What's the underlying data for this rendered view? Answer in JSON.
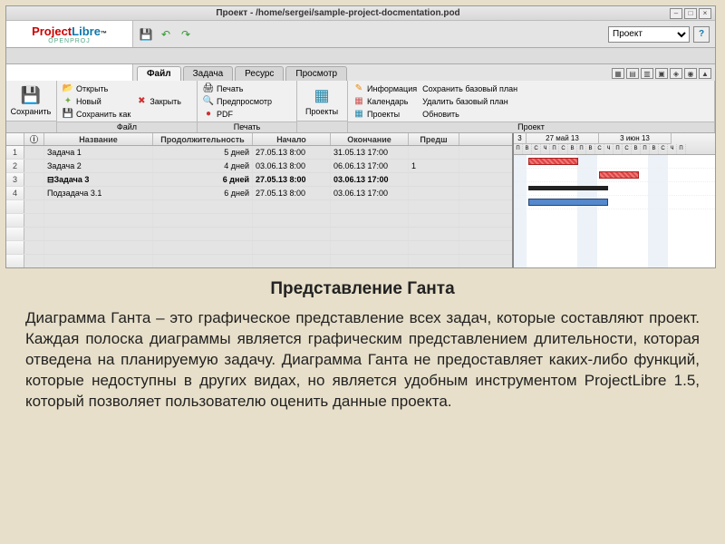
{
  "window": {
    "title": "Проект - /home/sergei/sample-project-docmentation.pod"
  },
  "logo": {
    "p": "Project",
    "l": "Libre",
    "tm": "™",
    "sub": "OPENPROJ"
  },
  "combo": {
    "selected": "Проект"
  },
  "tabs": {
    "file": "Файл",
    "task": "Задача",
    "resource": "Ресурс",
    "view": "Просмотр"
  },
  "ribbon": {
    "save": "Сохранить",
    "file_group": "Файл",
    "open": "Открыть",
    "new": "Новый",
    "saveas": "Сохранить как",
    "close": "Закрыть",
    "print_group": "Печать",
    "print": "Печать",
    "preview": "Предпросмотр",
    "pdf": "PDF",
    "projects": "Проекты",
    "project_group": "Проект",
    "info": "Информация",
    "calendar": "Календарь",
    "projects2": "Проекты",
    "save_baseline": "Сохранить базовый план",
    "delete_baseline": "Удалить базовый план",
    "refresh": "Обновить"
  },
  "columns": {
    "indicator": "ⓘ",
    "name": "Название",
    "duration": "Продолжительность",
    "start": "Начало",
    "end": "Окончание",
    "pred": "Предш"
  },
  "rows": [
    {
      "n": "1",
      "name": "Задача 1",
      "dur": "5 дней",
      "start": "27.05.13 8:00",
      "end": "31.05.13 17:00",
      "pred": ""
    },
    {
      "n": "2",
      "name": "Задача 2",
      "dur": "4 дней",
      "start": "03.06.13 8:00",
      "end": "06.06.13 17:00",
      "pred": "1"
    },
    {
      "n": "3",
      "name": "⊟Задача 3",
      "dur": "6 дней",
      "start": "27.05.13 8:00",
      "end": "03.06.13 17:00",
      "pred": "",
      "bold": true
    },
    {
      "n": "4",
      "name": "   Подзадача 3.1",
      "dur": "6 дней",
      "start": "27.05.13 8:00",
      "end": "03.06.13 17:00",
      "pred": ""
    }
  ],
  "timeline": {
    "w1": "3",
    "w2": "27 май 13",
    "w3": "3 июн 13",
    "days": "П В С Ч П С В П В С Ч П С В П В С Ч П"
  },
  "article": {
    "title": "Представление Ганта",
    "body": "Диаграмма Ганта – это графическое представление всех задач, которые составляют проект. Каждая полоска диаграммы является графическим представлением длительности, которая отведена на планируемую задачу. Диаграмма Ганта не предоставляет каких-либо функций, которые недоступны в других видах, но является удобным инструментом ProjectLibre 1.5, который позволяет пользователю оценить данные проекта."
  }
}
